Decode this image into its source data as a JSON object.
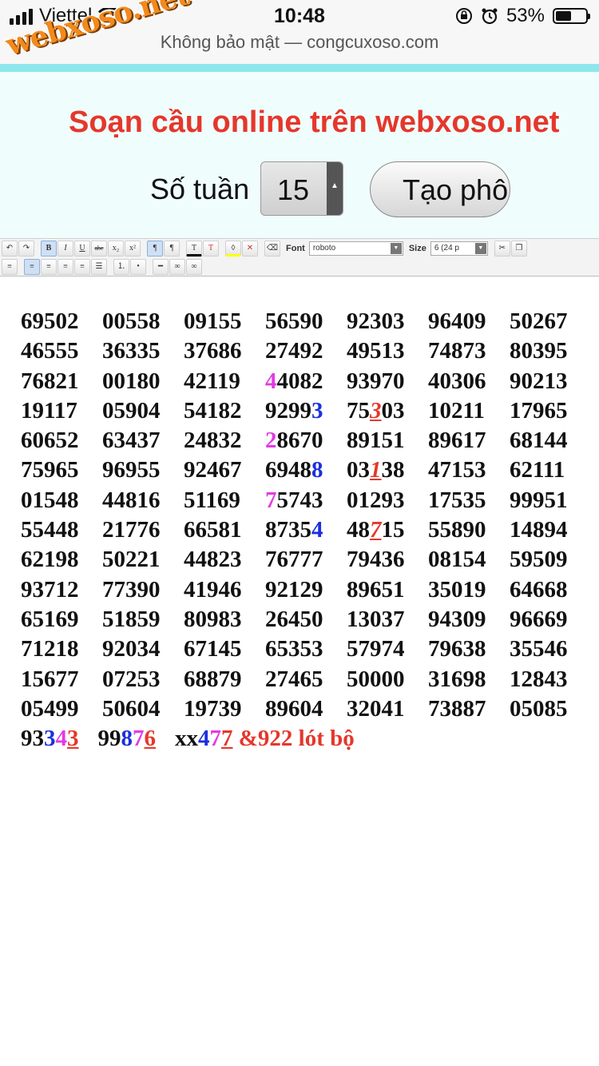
{
  "status": {
    "carrier": "Viettel",
    "time": "10:48",
    "battery_text": "53%",
    "battery_level": 0.53,
    "url_text": "Không bảo mật — congcuxoso.com"
  },
  "watermark": "webxoso.net",
  "header": {
    "title": "Soạn cầu online trên webxoso.net",
    "weeks_label": "Số tuần",
    "weeks_value": "15",
    "create_button": "Tạo phô"
  },
  "toolbar": {
    "font_label": "Font",
    "font_value": "roboto",
    "size_label": "Size",
    "size_value": "6 (24 p"
  },
  "rows": [
    [
      [
        {
          "t": "69502"
        }
      ],
      [
        {
          "t": "00558"
        }
      ],
      [
        {
          "t": "09155"
        }
      ],
      [
        {
          "t": "56590"
        }
      ],
      [
        {
          "t": "92303"
        }
      ],
      [
        {
          "t": "96409"
        }
      ],
      [
        {
          "t": "50267"
        }
      ]
    ],
    [
      [
        {
          "t": "46555"
        }
      ],
      [
        {
          "t": "36335"
        }
      ],
      [
        {
          "t": "37686"
        }
      ],
      [
        {
          "t": "27492"
        }
      ],
      [
        {
          "t": "49513"
        }
      ],
      [
        {
          "t": "74873"
        }
      ],
      [
        {
          "t": "80395"
        }
      ]
    ],
    [
      [
        {
          "t": "76821"
        }
      ],
      [
        {
          "t": "00180"
        }
      ],
      [
        {
          "t": "42119"
        }
      ],
      [
        {
          "t": "4",
          "c": "mag"
        },
        {
          "t": "4082"
        }
      ],
      [
        {
          "t": "93970"
        }
      ],
      [
        {
          "t": "40306"
        }
      ],
      [
        {
          "t": "90213"
        }
      ]
    ],
    [
      [
        {
          "t": "19117"
        }
      ],
      [
        {
          "t": "05904"
        }
      ],
      [
        {
          "t": "54182"
        }
      ],
      [
        {
          "t": "9299"
        },
        {
          "t": "3",
          "c": "blue"
        }
      ],
      [
        {
          "t": "75"
        },
        {
          "t": "3",
          "c": "red ul it"
        },
        {
          "t": "03"
        }
      ],
      [
        {
          "t": "10211"
        }
      ],
      [
        {
          "t": "17965"
        }
      ]
    ],
    [
      [
        {
          "t": "60652"
        }
      ],
      [
        {
          "t": "63437"
        }
      ],
      [
        {
          "t": "24832"
        }
      ],
      [
        {
          "t": "2",
          "c": "mag"
        },
        {
          "t": "8670"
        }
      ],
      [
        {
          "t": "89151"
        }
      ],
      [
        {
          "t": "89617"
        }
      ],
      [
        {
          "t": "68144"
        }
      ]
    ],
    [
      [
        {
          "t": "75965"
        }
      ],
      [
        {
          "t": "96955"
        }
      ],
      [
        {
          "t": "92467"
        }
      ],
      [
        {
          "t": "6948"
        },
        {
          "t": "8",
          "c": "blue"
        }
      ],
      [
        {
          "t": "03"
        },
        {
          "t": "1",
          "c": "red ul it"
        },
        {
          "t": "38"
        }
      ],
      [
        {
          "t": "47153"
        }
      ],
      [
        {
          "t": "62111"
        }
      ]
    ],
    [
      [
        {
          "t": "01548"
        }
      ],
      [
        {
          "t": "44816"
        }
      ],
      [
        {
          "t": "51169"
        }
      ],
      [
        {
          "t": "7",
          "c": "mag"
        },
        {
          "t": "5743"
        }
      ],
      [
        {
          "t": "01293"
        }
      ],
      [
        {
          "t": "17535"
        }
      ],
      [
        {
          "t": "99951"
        }
      ]
    ],
    [
      [
        {
          "t": "55448"
        }
      ],
      [
        {
          "t": "21776"
        }
      ],
      [
        {
          "t": "66581"
        }
      ],
      [
        {
          "t": "8735"
        },
        {
          "t": "4",
          "c": "blue"
        }
      ],
      [
        {
          "t": "48"
        },
        {
          "t": "7",
          "c": "red ul it"
        },
        {
          "t": "15"
        }
      ],
      [
        {
          "t": "55890"
        }
      ],
      [
        {
          "t": "14894"
        }
      ]
    ],
    [
      [
        {
          "t": "62198"
        }
      ],
      [
        {
          "t": "50221"
        }
      ],
      [
        {
          "t": "44823"
        }
      ],
      [
        {
          "t": "76777"
        }
      ],
      [
        {
          "t": "79436"
        }
      ],
      [
        {
          "t": "08154"
        }
      ],
      [
        {
          "t": "59509"
        }
      ]
    ],
    [
      [
        {
          "t": "93712"
        }
      ],
      [
        {
          "t": "77390"
        }
      ],
      [
        {
          "t": "41946"
        }
      ],
      [
        {
          "t": "92129"
        }
      ],
      [
        {
          "t": "89651"
        }
      ],
      [
        {
          "t": "35019"
        }
      ],
      [
        {
          "t": "64668"
        }
      ]
    ],
    [
      [
        {
          "t": "65169"
        }
      ],
      [
        {
          "t": "51859"
        }
      ],
      [
        {
          "t": "80983"
        }
      ],
      [
        {
          "t": "26450"
        }
      ],
      [
        {
          "t": "13037"
        }
      ],
      [
        {
          "t": "94309"
        }
      ],
      [
        {
          "t": "96669"
        }
      ]
    ],
    [
      [
        {
          "t": "71218"
        }
      ],
      [
        {
          "t": "92034"
        }
      ],
      [
        {
          "t": "67145"
        }
      ],
      [
        {
          "t": "65353"
        }
      ],
      [
        {
          "t": "57974"
        }
      ],
      [
        {
          "t": "79638"
        }
      ],
      [
        {
          "t": "35546"
        }
      ]
    ],
    [
      [
        {
          "t": "15677"
        }
      ],
      [
        {
          "t": "07253"
        }
      ],
      [
        {
          "t": "68879"
        }
      ],
      [
        {
          "t": "27465"
        }
      ],
      [
        {
          "t": "50000"
        }
      ],
      [
        {
          "t": "31698"
        }
      ],
      [
        {
          "t": "12843"
        }
      ]
    ],
    [
      [
        {
          "t": "05499"
        }
      ],
      [
        {
          "t": "50604"
        }
      ],
      [
        {
          "t": "19739"
        }
      ],
      [
        {
          "t": "89604"
        }
      ],
      [
        {
          "t": "32041"
        }
      ],
      [
        {
          "t": "73887"
        }
      ],
      [
        {
          "t": "05085"
        }
      ]
    ],
    [
      [
        {
          "t": "93"
        },
        {
          "t": "3",
          "c": "blue"
        },
        {
          "t": "4",
          "c": "mag"
        },
        {
          "t": "3",
          "c": "red ul"
        }
      ],
      [
        {
          "t": "99"
        },
        {
          "t": "8",
          "c": "blue"
        },
        {
          "t": "7",
          "c": "mag"
        },
        {
          "t": "6",
          "c": "red ul"
        }
      ],
      [
        {
          "t": "xx"
        },
        {
          "t": "4",
          "c": "blue"
        },
        {
          "t": "7",
          "c": "mag"
        },
        {
          "t": "7",
          "c": "red ul"
        },
        {
          "t": " &922 lót bộ",
          "c": "red"
        }
      ]
    ]
  ]
}
